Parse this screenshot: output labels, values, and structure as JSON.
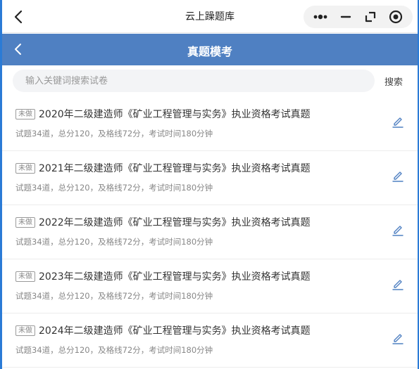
{
  "titlebar": {
    "title": "云上躁题库"
  },
  "navbar": {
    "title": "真题模考"
  },
  "search": {
    "placeholder": "输入关键词搜索试卷",
    "button_label": "搜索"
  },
  "exams": [
    {
      "badge": "未做",
      "title": "2020年二级建造师《矿业工程管理与实务》执业资格考试真题",
      "meta": "试题34道，总分120，及格线72分，考试时间180分钟"
    },
    {
      "badge": "未做",
      "title": "2021年二级建造师《矿业工程管理与实务》执业资格考试真题",
      "meta": "试题34道，总分120，及格线72分，考试时间180分钟"
    },
    {
      "badge": "未做",
      "title": "2022年二级建造师《矿业工程管理与实务》执业资格考试真题",
      "meta": "试题34道，总分120，及格线72分，考试时间180分钟"
    },
    {
      "badge": "未做",
      "title": "2023年二级建造师《矿业工程管理与实务》执业资格考试真题",
      "meta": "试题34道，总分120，及格线72分，考试时间180分钟"
    },
    {
      "badge": "未做",
      "title": "2024年二级建造师《矿业工程管理与实务》执业资格考试真题",
      "meta": "试题34道，总分120，及格线72分，考试时间180分钟"
    }
  ],
  "colors": {
    "nav_bg": "#4f80c2",
    "frame": "#2b7bd6",
    "edit_icon": "#4f80c2"
  },
  "icons": {
    "titlebar_back": "chevron-left-icon",
    "more": "more-dots-icon",
    "minimize": "minimize-icon",
    "restore": "restore-icon",
    "close": "target-close-icon",
    "nav_back": "chevron-left-icon",
    "edit": "pencil-icon"
  }
}
